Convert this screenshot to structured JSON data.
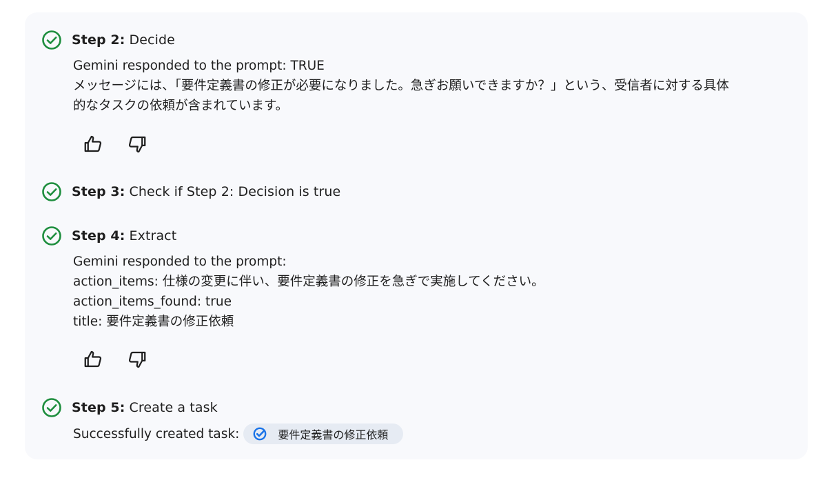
{
  "steps": [
    {
      "label": "Step 2:",
      "name": "Decide",
      "response_lines": [
        "Gemini responded to the prompt: TRUE",
        "メッセージには、「要件定義書の修正が必要になりました。急ぎお願いできますか？」という、受信者に対する具体",
        "的なタスクの依頼が含まれています。"
      ]
    },
    {
      "label": "Step 3:",
      "name": "Check if Step 2: Decision is true"
    },
    {
      "label": "Step 4:",
      "name": "Extract",
      "response_lines": [
        "Gemini responded to the prompt:",
        "action_items: 仕様の変更に伴い、要件定義書の修正を急ぎで実施してください。",
        "action_items_found: true",
        "title: 要件定義書の修正依頼"
      ]
    },
    {
      "label": "Step 5:",
      "name": "Create a task",
      "result_text": "Successfully created task:",
      "task_chip": "要件定義書の修正依頼"
    }
  ],
  "icons": {
    "step_status": "check-circle-icon",
    "thumbs_up": "thumbs-up-icon",
    "thumbs_down": "thumbs-down-icon",
    "task": "task-check-icon"
  },
  "colors": {
    "success_green": "#1e8e3e",
    "task_blue": "#1a73e8",
    "panel_bg": "#f8f9fc",
    "chip_bg": "#e6ebf3"
  }
}
